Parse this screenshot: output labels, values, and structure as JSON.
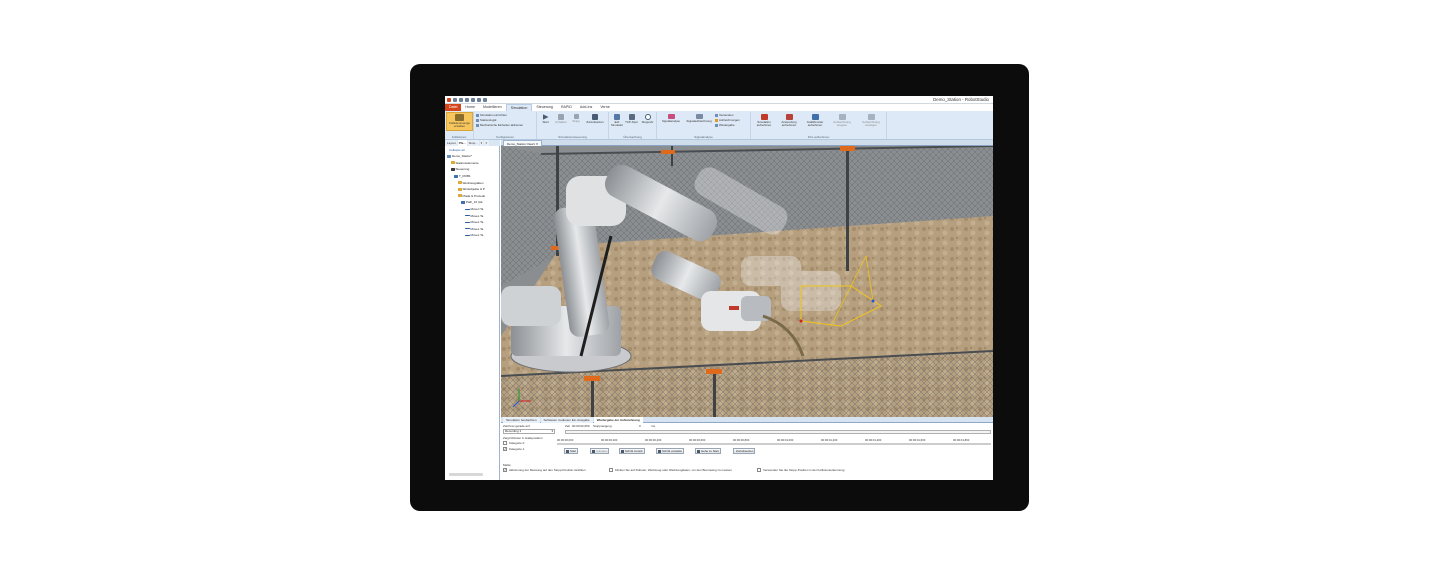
{
  "window": {
    "title": "Demo_Station - RobotStudio"
  },
  "ribbon": {
    "tabs": [
      "Datei",
      "Home",
      "Modellieren",
      "Simulation",
      "Steuerung",
      "RAPID",
      "Add-Ins",
      "Verne"
    ],
    "active_tab": "Simulation",
    "groups": {
      "kollisionen": {
        "label": "Kollisionen",
        "button": "Kollisionsmenge erstellen"
      },
      "konfigurieren": {
        "label": "Konfigurieren",
        "items": [
          "Simulation einrichten",
          "Stationslogik",
          "Mechanische Einheiten aktivieren"
        ]
      },
      "simulationssteuerung": {
        "label": "Simulationssteuerung",
        "buttons": [
          "Start",
          "Anhalten",
          "Stopp",
          "Zurücksetzen"
        ]
      },
      "ueberwachung": {
        "label": "Überwachung",
        "buttons": [
          "E/A Simulator",
          "TCP-Spur",
          "Stoppuhr"
        ]
      },
      "signalanalyse": {
        "label": "Signalanalyse",
        "buttons": [
          "Signalanalyse",
          "Signalaufzeichnung"
        ],
        "items": [
          "Verwenden",
          "Aufzeichnungen",
          "Wiedergabe"
        ]
      },
      "film": {
        "label": "Film aufnehmen",
        "buttons": [
          "Simulation aufnehmen",
          "Anwendung aufnehmen",
          "Grafikfenster aufnehmen",
          "Aufzeichnung stoppen",
          "Aufzeichnung anzeigen"
        ]
      }
    }
  },
  "left_panel": {
    "tabs": [
      "Layout",
      "Pfa...",
      "Simp...",
      "▾",
      "✕"
    ],
    "collapse_label": "Collapse all",
    "tree": [
      {
        "text": "Demo_Station*",
        "level": 0,
        "icon": "station-icon"
      },
      {
        "text": "Stationselemente",
        "level": 1,
        "icon": "folder-icon"
      },
      {
        "text": "Steuerung",
        "level": 1,
        "icon": "controller-icon"
      },
      {
        "text": "T_ROB1",
        "level": 2,
        "icon": "task-icon"
      },
      {
        "text": "Werkzeugdaten",
        "level": 3,
        "icon": "folder-icon"
      },
      {
        "text": "Werkobjekte & P",
        "level": 3,
        "icon": "folder-icon"
      },
      {
        "text": "Pfade & Prozedu",
        "level": 3,
        "icon": "folder-icon"
      },
      {
        "text": "Path_10 (Ak",
        "level": 4,
        "icon": "path-icon"
      },
      {
        "text": "MoveJ Ta",
        "level": 5,
        "icon": "move-icon"
      },
      {
        "text": "MoveL Ta",
        "level": 5,
        "icon": "move-icon"
      },
      {
        "text": "MoveL Ta",
        "level": 5,
        "icon": "move-icon"
      },
      {
        "text": "MoveL Ta",
        "level": 5,
        "icon": "move-icon"
      },
      {
        "text": "MoveL Ta",
        "level": 5,
        "icon": "move-icon"
      }
    ]
  },
  "document": {
    "tab": "Demo_Station:View1 ✕"
  },
  "bottom_panel": {
    "tabs": [
      "Simulation beobachten",
      "Softwarec. bedienen Ein-/Ausgabe",
      "Wiedergabe der Aufzeichnung"
    ],
    "active_tab": "Wiedergabe der Aufzeichnung",
    "recording_label": "Zeichnet gerade auf",
    "recording_value": "Recording 1",
    "zeit_label": "Zeit",
    "zeit_value": "00:00:02,050",
    "stopp_label": "Stoppneigung",
    "stopp_value": "0",
    "stopp_unit": "ms",
    "show_robots_label": "Zeigt Roboter in Halteposition",
    "categories": [
      {
        "label": "Kategorie 0",
        "checked": false
      },
      {
        "label": "Kategorie 1",
        "checked": true
      }
    ],
    "timeline": [
      "00:00:00,000",
      "00:00:00,200",
      "00:00:00,400",
      "00:00:00,600",
      "00:00:00,800",
      "00:00:01,000",
      "00:00:01,200",
      "00:00:01,400",
      "00:00:01,600",
      "00:00:01,800"
    ],
    "buttons": [
      "Start",
      "Anhalten",
      "Schritt zurück",
      "Schritt vorwärts",
      "Gehe zu Start",
      "Zurücksetzen"
    ],
    "misc_label": "Maße",
    "options": [
      {
        "label": "Aktivierung der Messung auf den Stopp-Position-Grafiken",
        "checked": true
      },
      {
        "label": "Klicken Sie auf Roboter, Werkzeug oder Werkzeugdaten, um den Bremsweg zu messen",
        "checked": false
      },
      {
        "label": "Verwenden Sie die Stopp-Position in der Kollisionserkennung",
        "checked": false
      }
    ]
  },
  "colors": {
    "file_tab": "#d5451b",
    "ribbon": "#dde9f6",
    "fence_post": "#e06a1c",
    "tcp_path": "#f0c419"
  }
}
